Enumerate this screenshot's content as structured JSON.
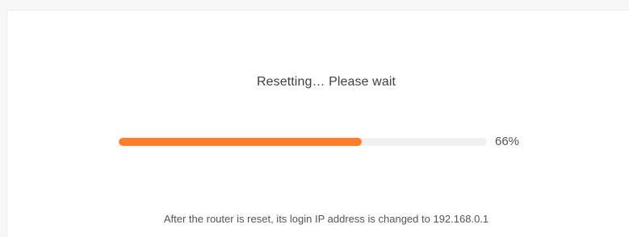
{
  "reset_dialog": {
    "status_text": "Resetting… Please wait",
    "progress": {
      "value_percent": 66,
      "label": "66%",
      "fill_color": "#ff7e29",
      "track_color": "#f1f1f1"
    },
    "note_text": "After the router is reset, its login IP address is changed to 192.168.0.1"
  }
}
